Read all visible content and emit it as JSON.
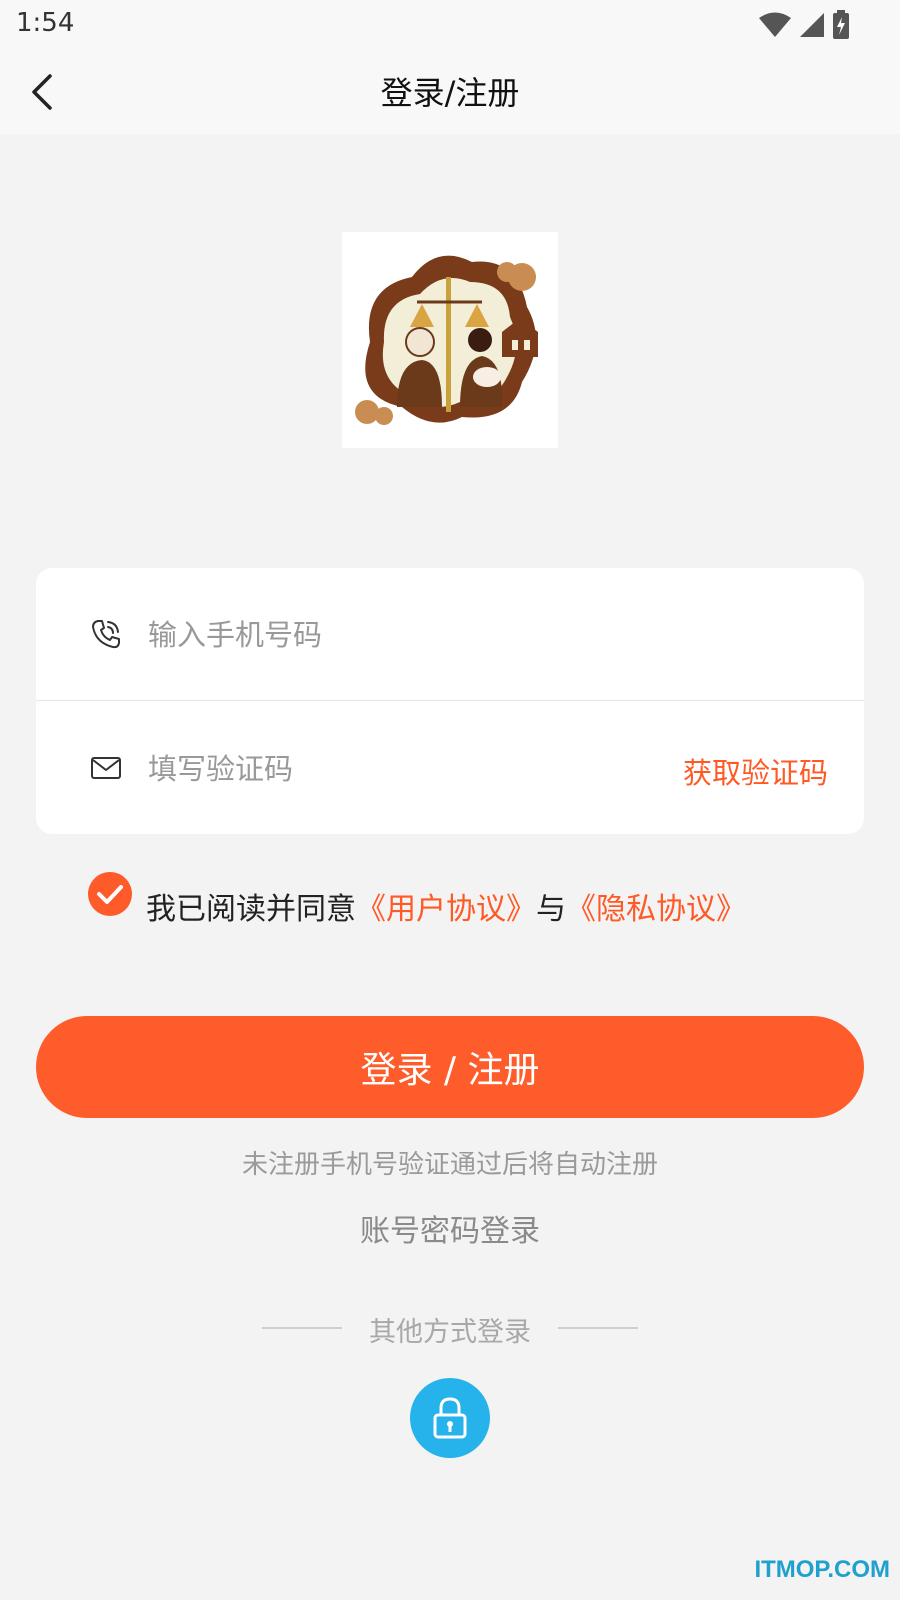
{
  "status_bar": {
    "time": "1:54"
  },
  "header": {
    "title": "登录/注册"
  },
  "form": {
    "phone_placeholder": "输入手机号码",
    "phone_value": "",
    "code_placeholder": "填写验证码",
    "code_value": "",
    "get_code_label": "获取验证码"
  },
  "agreement": {
    "checked": true,
    "prefix": "我已阅读并同意",
    "user_agreement": "《用户协议》",
    "conjunction": "与",
    "privacy_agreement": "《隐私协议》"
  },
  "login_button": {
    "label": "登录 / 注册"
  },
  "auto_register_tip": "未注册手机号验证通过后将自动注册",
  "password_login_label": "账号密码登录",
  "other_methods_label": "其他方式登录",
  "watermark": "ITMOP.COM",
  "colors": {
    "accent": "#ff5c2b",
    "lock_button": "#26b2ea",
    "background": "#f3f3f3"
  }
}
